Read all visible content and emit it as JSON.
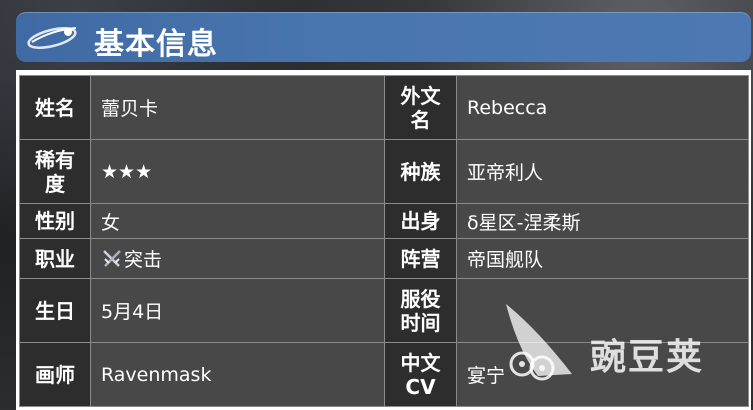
{
  "header": {
    "title": "基本信息",
    "icon": "comet-icon"
  },
  "table": {
    "rows": [
      {
        "k1": "姓名",
        "v1": "蕾贝卡",
        "k2": "外文名",
        "v2": "Rebecca"
      },
      {
        "k1": "稀有度",
        "v1": "★★★",
        "k2": "种族",
        "v2": "亚帝利人"
      },
      {
        "k1": "性别",
        "v1": "女",
        "k2": "出身",
        "v2": "δ星区-涅柔斯"
      },
      {
        "k1": "职业",
        "v1": "突击",
        "k2": "阵营",
        "v2": "帝国舰队"
      },
      {
        "k1": "生日",
        "v1": "5月4日",
        "k2": "服役时间",
        "v2": ""
      },
      {
        "k1": "画师",
        "v1": "Ravenmask",
        "k2": "中文CV",
        "v2": "宴宁"
      }
    ]
  },
  "watermark": {
    "text": "豌豆荚"
  },
  "colors": {
    "header": "#4a76b0",
    "key_cell": "#242424",
    "value_cell": "#3a3a3a",
    "border": "#8b8b8b"
  }
}
